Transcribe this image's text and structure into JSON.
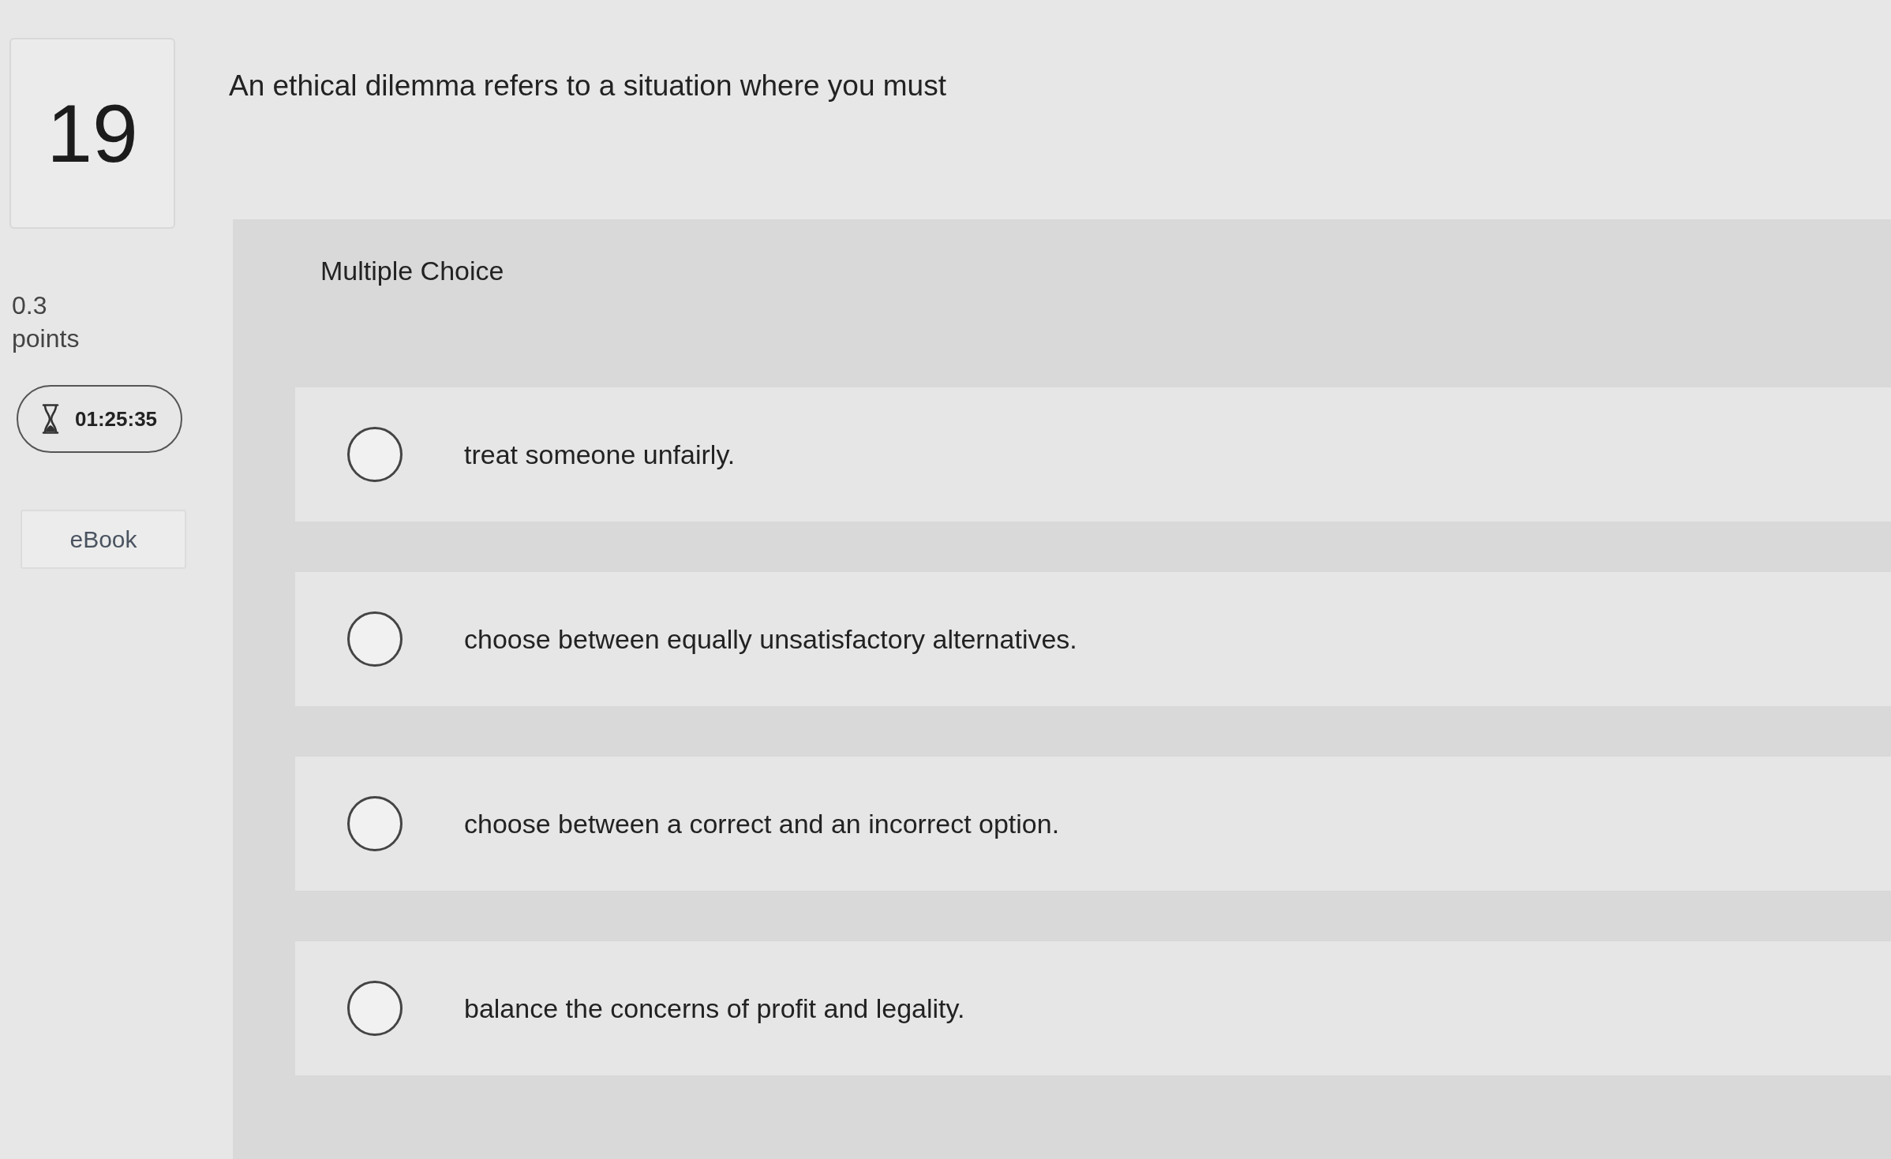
{
  "question": {
    "number": "19",
    "points": "0.3",
    "points_label": "points",
    "timer": "01:25:35",
    "ebook": "eBook",
    "prompt": "An ethical dilemma refers to a situation where you must"
  },
  "answer_panel": {
    "type_label": "Multiple Choice",
    "options": [
      {
        "label": "treat someone unfairly.",
        "selected": false
      },
      {
        "label": "choose between equally unsatisfactory alternatives.",
        "selected": false
      },
      {
        "label": "choose between a correct and an incorrect option.",
        "selected": false
      },
      {
        "label": "balance the concerns of profit and legality.",
        "selected": false
      }
    ]
  }
}
